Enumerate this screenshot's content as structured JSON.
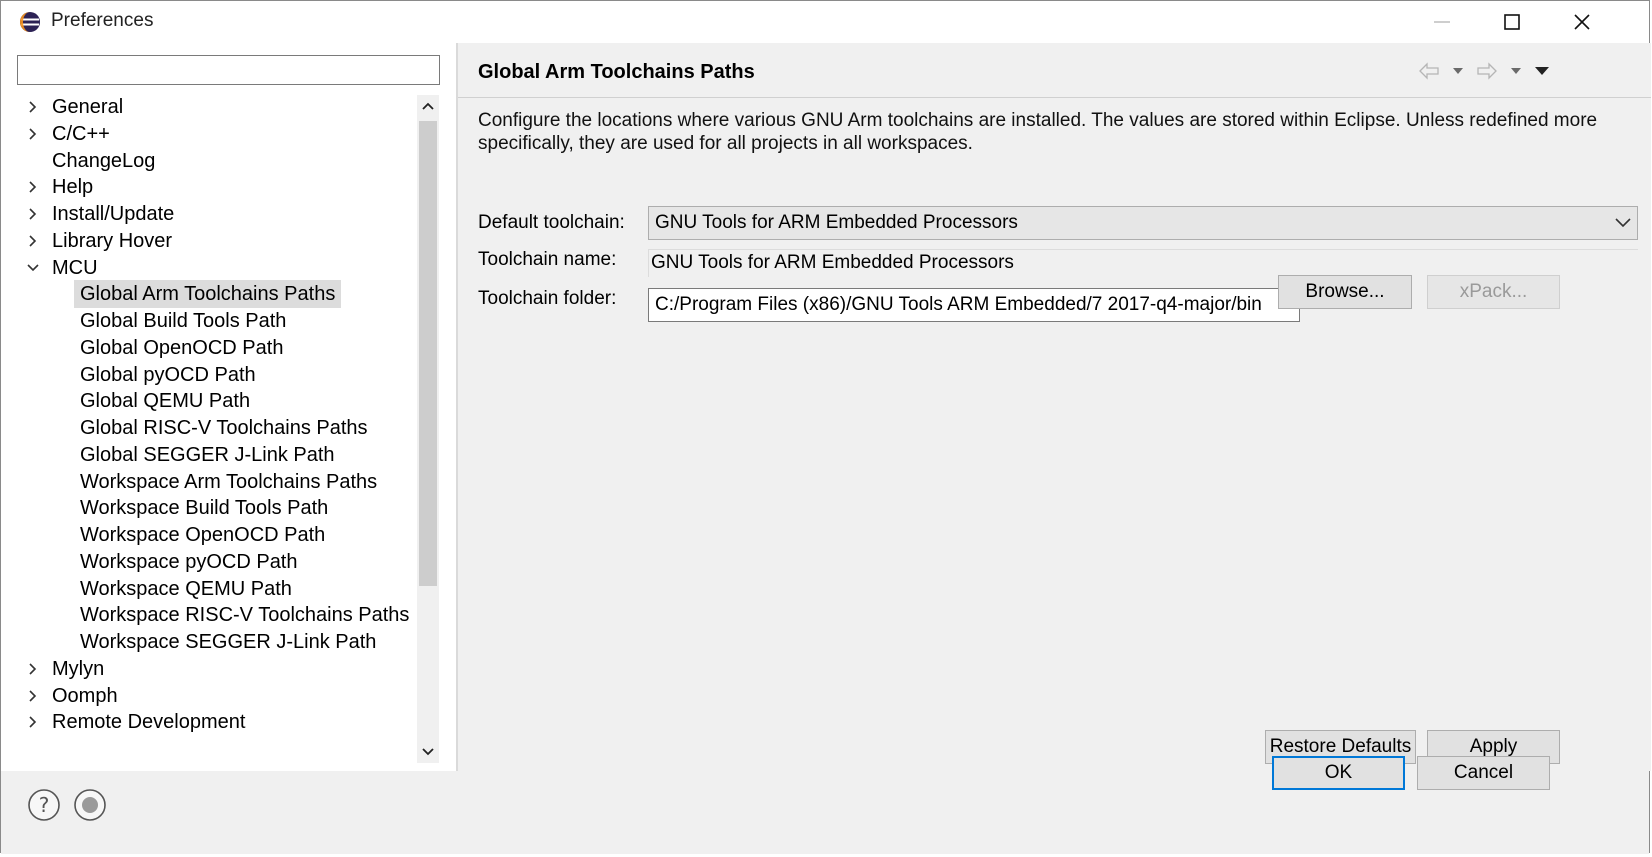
{
  "window": {
    "title": "Preferences"
  },
  "filter": {
    "value": ""
  },
  "tree": [
    {
      "label": "General",
      "expander": "collapsed",
      "level": 0
    },
    {
      "label": "C/C++",
      "expander": "collapsed",
      "level": 0
    },
    {
      "label": "ChangeLog",
      "expander": "none",
      "level": 0
    },
    {
      "label": "Help",
      "expander": "collapsed",
      "level": 0
    },
    {
      "label": "Install/Update",
      "expander": "collapsed",
      "level": 0
    },
    {
      "label": "Library Hover",
      "expander": "collapsed",
      "level": 0
    },
    {
      "label": "MCU",
      "expander": "expanded",
      "level": 0
    },
    {
      "label": "Global Arm Toolchains Paths",
      "expander": "none",
      "level": 1,
      "selected": true
    },
    {
      "label": "Global Build Tools Path",
      "expander": "none",
      "level": 1
    },
    {
      "label": "Global OpenOCD Path",
      "expander": "none",
      "level": 1
    },
    {
      "label": "Global pyOCD Path",
      "expander": "none",
      "level": 1
    },
    {
      "label": "Global QEMU Path",
      "expander": "none",
      "level": 1
    },
    {
      "label": "Global RISC-V Toolchains Paths",
      "expander": "none",
      "level": 1
    },
    {
      "label": "Global SEGGER J-Link Path",
      "expander": "none",
      "level": 1
    },
    {
      "label": "Workspace Arm Toolchains Paths",
      "expander": "none",
      "level": 1
    },
    {
      "label": "Workspace Build Tools Path",
      "expander": "none",
      "level": 1
    },
    {
      "label": "Workspace OpenOCD Path",
      "expander": "none",
      "level": 1
    },
    {
      "label": "Workspace pyOCD Path",
      "expander": "none",
      "level": 1
    },
    {
      "label": "Workspace QEMU Path",
      "expander": "none",
      "level": 1
    },
    {
      "label": "Workspace RISC-V Toolchains Paths",
      "expander": "none",
      "level": 1
    },
    {
      "label": "Workspace SEGGER J-Link Path",
      "expander": "none",
      "level": 1
    },
    {
      "label": "Mylyn",
      "expander": "collapsed",
      "level": 0
    },
    {
      "label": "Oomph",
      "expander": "collapsed",
      "level": 0
    },
    {
      "label": "Remote Development",
      "expander": "collapsed",
      "level": 0
    }
  ],
  "page": {
    "title": "Global Arm Toolchains Paths",
    "description": "Configure the locations where various GNU Arm toolchains are installed. The values are stored within Eclipse. Unless redefined more specifically, they are used for all projects in all workspaces.",
    "default_toolchain_label": "Default toolchain:",
    "default_toolchain_value": "GNU Tools for ARM Embedded Processors",
    "toolchain_name_label": "Toolchain name:",
    "toolchain_name_value": "GNU Tools for ARM Embedded Processors",
    "toolchain_folder_label": "Toolchain folder:",
    "toolchain_folder_value": "C:/Program Files (x86)/GNU Tools ARM Embedded/7 2017-q4-major/bin",
    "browse_label": "Browse...",
    "xpack_label": "xPack...",
    "restore_defaults_label": "Restore Defaults",
    "apply_label": "Apply"
  },
  "footer": {
    "ok_label": "OK",
    "cancel_label": "Cancel"
  },
  "colors": {
    "accent": "#0078d7",
    "selection": "#dcdcdc",
    "background": "#f0f0f0"
  }
}
